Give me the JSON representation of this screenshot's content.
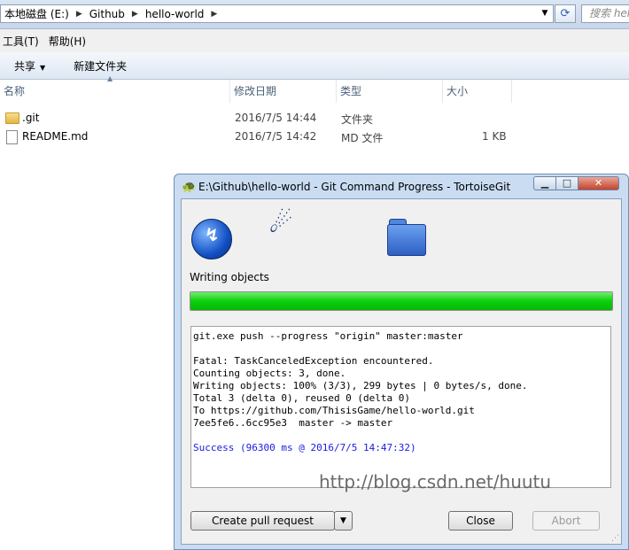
{
  "explorer": {
    "breadcrumb": [
      "本地磁盘 (E:)",
      "Github",
      "hello-world"
    ],
    "search_placeholder": "搜索 hello-world",
    "menu": [
      "工具(T)",
      "帮助(H)"
    ],
    "toolbar": {
      "share_label": "共享",
      "new_folder_label": "新建文件夹"
    },
    "columns": {
      "name": "名称",
      "date": "修改日期",
      "type": "类型",
      "size": "大小"
    },
    "files": [
      {
        "name": ".git",
        "date": "2016/7/5 14:44",
        "type": "文件夹",
        "size": "",
        "icon": "folder-icon"
      },
      {
        "name": "README.md",
        "date": "2016/7/5 14:42",
        "type": "MD 文件",
        "size": "1 KB",
        "icon": "document-icon"
      }
    ]
  },
  "dialog": {
    "title": "E:\\Github\\hello-world - Git Command Progress - TortoiseGit",
    "operation_label": "Writing objects",
    "progress_fraction": 1.0,
    "log_lines": [
      "git.exe push --progress \"origin\" master:master",
      "",
      "Fatal: TaskCanceledException encountered.",
      "Counting objects: 3, done.",
      "Writing objects: 100% (3/3), 299 bytes | 0 bytes/s, done.",
      "Total 3 (delta 0), reused 0 (delta 0)",
      "To https://github.com/ThisisGame/hello-world.git",
      "7ee5fe6..6cc95e3  master -> master",
      ""
    ],
    "success_line": "Success (96300 ms @ 2016/7/5 14:47:32)",
    "watermark": "http://blog.csdn.net/huutu",
    "buttons": {
      "create_pull_request": "Create pull request",
      "close": "Close",
      "abort": "Abort"
    },
    "colors": {
      "progress": "#0ccf0c",
      "success_text": "#1a1ae0"
    }
  }
}
